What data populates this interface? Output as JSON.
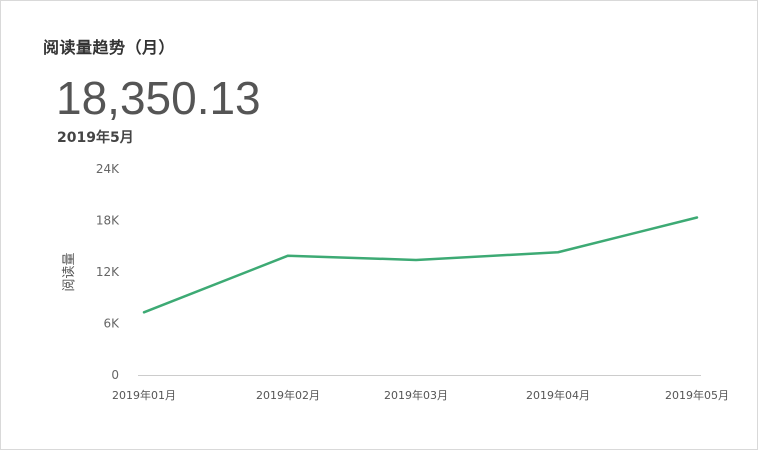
{
  "header": {
    "title": "阅读量趋势（月）",
    "value": "18,350.13",
    "period": "2019年5月"
  },
  "colors": {
    "line": "#3daa74",
    "axis": "#cccccc"
  },
  "chart_data": {
    "type": "line",
    "categories": [
      "2019年01月",
      "2019年02月",
      "2019年03月",
      "2019年04月",
      "2019年05月"
    ],
    "series": [
      {
        "values": [
          7300,
          13900,
          13400,
          14300,
          18350.13
        ]
      }
    ],
    "title": "阅读量趋势（月）",
    "xlabel": "",
    "ylabel": "阅读量",
    "ylim": [
      0,
      24000
    ],
    "yticks": [
      0,
      6000,
      12000,
      18000,
      24000
    ],
    "ytick_labels": [
      "0",
      "6K",
      "12K",
      "18K",
      "24K"
    ],
    "grid": false,
    "legend": "none"
  }
}
